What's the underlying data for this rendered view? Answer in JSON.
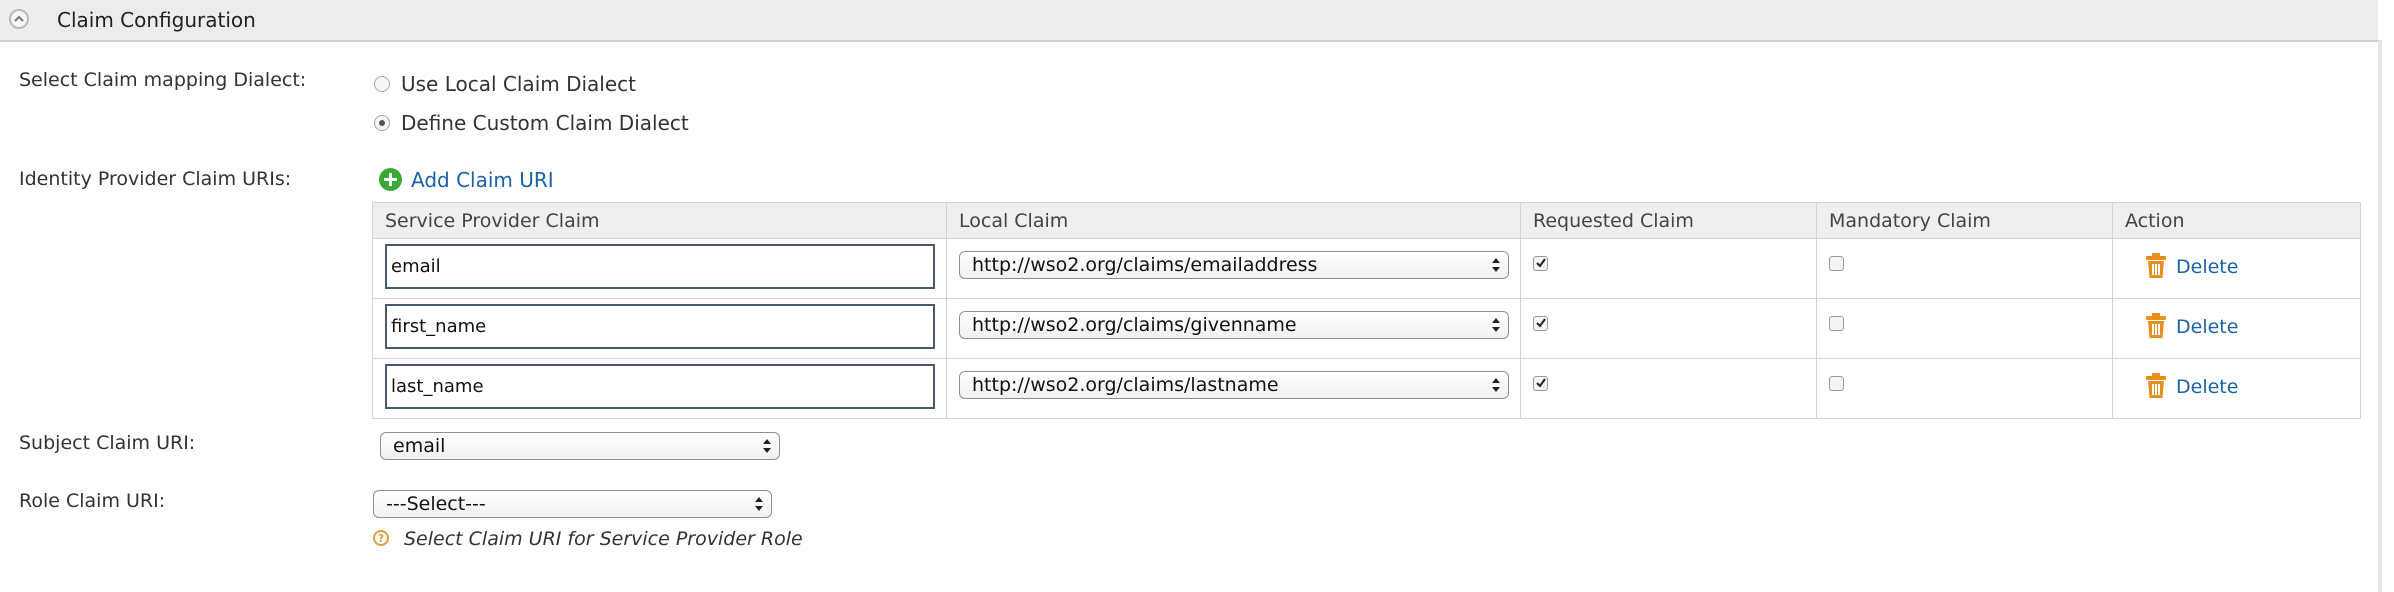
{
  "panel": {
    "title": "Claim Configuration",
    "collapse_icon": "chevron-up-icon"
  },
  "dialect": {
    "label": "Select Claim mapping Dialect:",
    "options": [
      {
        "label": "Use Local Claim Dialect",
        "checked": false
      },
      {
        "label": "Define Custom Claim Dialect",
        "checked": true
      }
    ]
  },
  "idp_claims": {
    "label": "Identity Provider Claim URIs:",
    "add_label": "Add Claim URI",
    "add_icon": "plus-circle-icon",
    "columns": [
      "Service Provider Claim",
      "Local Claim",
      "Requested Claim",
      "Mandatory Claim",
      "Action"
    ],
    "rows": [
      {
        "sp_claim": "email",
        "local_claim": "http://wso2.org/claims/emailaddress",
        "requested": true,
        "mandatory": false,
        "action": "Delete"
      },
      {
        "sp_claim": "first_name",
        "local_claim": "http://wso2.org/claims/givenname",
        "requested": true,
        "mandatory": false,
        "action": "Delete"
      },
      {
        "sp_claim": "last_name",
        "local_claim": "http://wso2.org/claims/lastname",
        "requested": true,
        "mandatory": false,
        "action": "Delete"
      }
    ]
  },
  "subject_claim": {
    "label": "Subject Claim URI:",
    "value": "email"
  },
  "role_claim": {
    "label": "Role Claim URI:",
    "value": "---Select---",
    "help_text": "Select Claim URI for Service Provider Role",
    "help_icon": "question-circle-icon"
  },
  "colors": {
    "link": "#1a63a8",
    "add_icon": "#3aaa35",
    "trash_icon": "#e8901f",
    "help_icon": "#d9a23a"
  }
}
